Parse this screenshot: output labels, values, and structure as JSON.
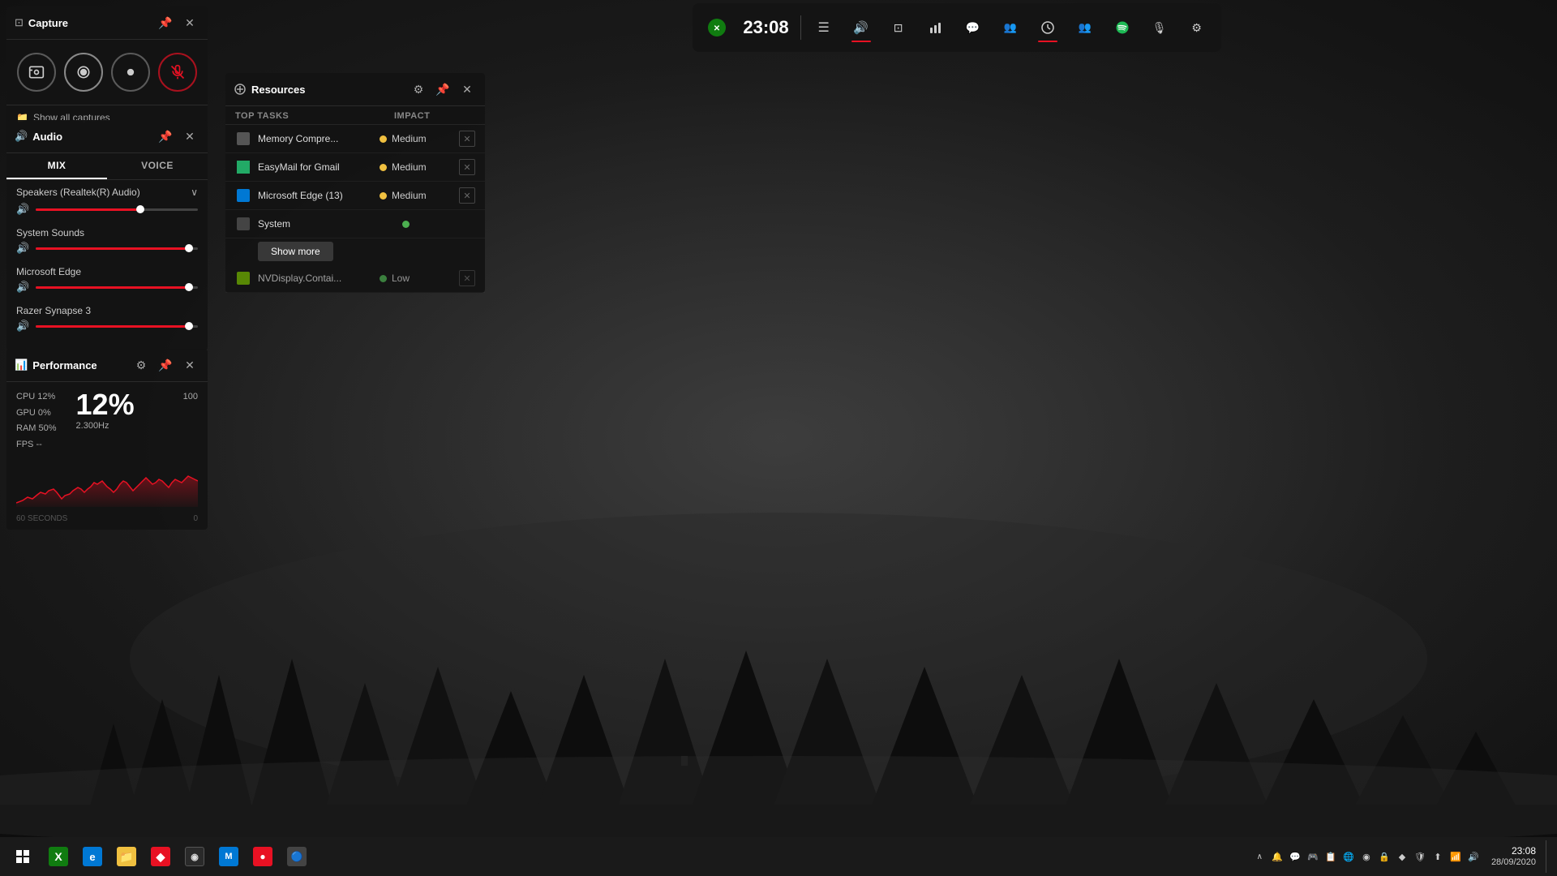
{
  "desktop": {
    "bg_color": "#2a2a2a"
  },
  "gamebar": {
    "time": "23:08",
    "buttons": [
      {
        "id": "menu",
        "symbol": "☰",
        "active": false,
        "underline": false
      },
      {
        "id": "audio",
        "symbol": "🔊",
        "active": false,
        "underline": true
      },
      {
        "id": "capture",
        "symbol": "📷",
        "active": false,
        "underline": false
      },
      {
        "id": "performance",
        "symbol": "📊",
        "active": false,
        "underline": false
      },
      {
        "id": "chat",
        "symbol": "💬",
        "active": false,
        "underline": false
      },
      {
        "id": "social",
        "symbol": "👥",
        "active": false,
        "underline": false
      },
      {
        "id": "activity",
        "symbol": "⏱",
        "active": false,
        "underline": true
      },
      {
        "id": "friends",
        "symbol": "👫",
        "active": false,
        "underline": false
      },
      {
        "id": "spotify",
        "symbol": "♫",
        "active": true,
        "underline": false
      },
      {
        "id": "mute",
        "symbol": "🎙",
        "active": false,
        "underline": false
      },
      {
        "id": "settings",
        "symbol": "⚙",
        "active": false,
        "underline": false
      }
    ]
  },
  "capture_panel": {
    "title": "Capture",
    "show_all_label": "Show all captures",
    "buttons": [
      {
        "id": "screenshot",
        "symbol": "📷"
      },
      {
        "id": "record",
        "symbol": "⏺"
      },
      {
        "id": "clip",
        "symbol": "●"
      },
      {
        "id": "mic",
        "symbol": "🎙",
        "muted": true
      }
    ]
  },
  "audio_panel": {
    "title": "Audio",
    "tabs": [
      "MIX",
      "VOICE"
    ],
    "active_tab": "MIX",
    "device": "Speakers (Realtek(R) Audio)",
    "channels": [
      {
        "label": "System Sounds",
        "volume": 95
      },
      {
        "label": "Microsoft Edge",
        "volume": 95
      },
      {
        "label": "Razer Synapse 3",
        "volume": 95
      }
    ]
  },
  "performance_panel": {
    "title": "Performance",
    "stats": [
      {
        "key": "CPU",
        "pct": "12%"
      },
      {
        "key": "GPU",
        "pct": "0%"
      },
      {
        "key": "RAM",
        "pct": "50%"
      },
      {
        "key": "FPS",
        "pct": "--"
      }
    ],
    "big_value": "12%",
    "frequency": "2.300Hz",
    "chart_seconds": "60 SECONDS",
    "chart_max": "100",
    "chart_min": "0"
  },
  "resources_panel": {
    "title": "Resources",
    "col_top_tasks": "TOP TASKS",
    "col_impact": "IMPACT",
    "tasks": [
      {
        "name": "Memory Compre...",
        "impact": "Medium",
        "impact_color": "yellow",
        "has_close": true
      },
      {
        "name": "EasyMail for Gmail",
        "impact": "Medium",
        "impact_color": "yellow",
        "has_close": true
      },
      {
        "name": "Microsoft Edge (13)",
        "impact": "Medium",
        "impact_color": "yellow",
        "has_close": true
      },
      {
        "name": "System",
        "impact": "",
        "impact_color": "green",
        "has_close": false,
        "show_more": true
      },
      {
        "name": "NVDisplay.Contai...",
        "impact": "Low",
        "impact_color": "green",
        "has_close": true
      }
    ],
    "show_more_label": "Show more"
  },
  "taskbar": {
    "time": "23:08",
    "date": "28/09/2020",
    "apps": [
      {
        "id": "start",
        "color": "#0078d4",
        "label": "⊞"
      },
      {
        "id": "xbox",
        "color": "#107c10",
        "label": "X"
      },
      {
        "id": "edge",
        "color": "#0078d4",
        "label": "e"
      },
      {
        "id": "explorer",
        "color": "#f0c040",
        "label": "📁"
      },
      {
        "id": "app4",
        "color": "#e81123",
        "label": "♦"
      },
      {
        "id": "app5",
        "color": "#888",
        "label": "R"
      },
      {
        "id": "app6",
        "color": "#0078d4",
        "label": "M"
      },
      {
        "id": "app7",
        "color": "#e81123",
        "label": "◉"
      },
      {
        "id": "app8",
        "color": "#444",
        "label": "🎮"
      }
    ],
    "tray_icons_count": 16
  }
}
